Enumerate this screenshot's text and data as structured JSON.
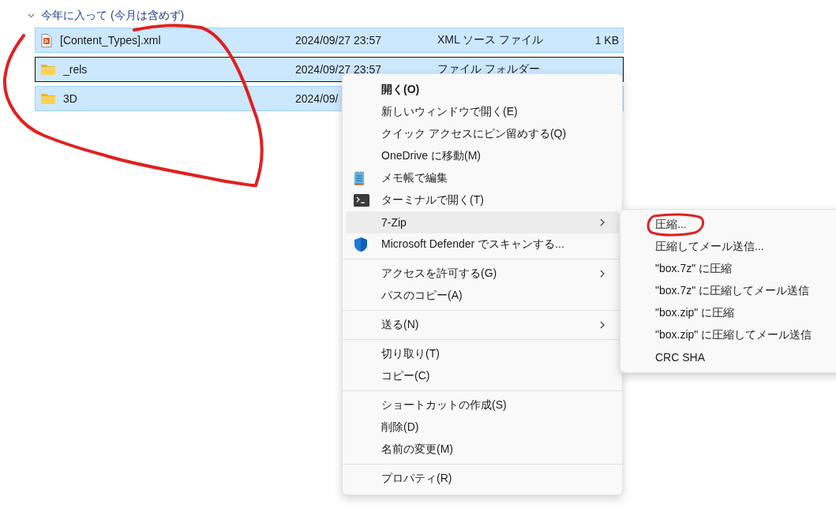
{
  "group": {
    "label": "今年に入って (今月は含めず)",
    "expanded": true
  },
  "files": {
    "circled": true,
    "rows": [
      {
        "kind": "xml",
        "name": "[Content_Types].xml",
        "date": "2024/09/27 23:57",
        "type": "XML ソース ファイル",
        "size": "1 KB",
        "selected": true,
        "focused": false
      },
      {
        "kind": "folder",
        "name": "_rels",
        "date": "2024/09/27 23:57",
        "type": "ファイル フォルダー",
        "selected": true,
        "focused": true
      },
      {
        "kind": "folder",
        "name": "3D",
        "date": "2024/09/",
        "selected": true,
        "focused": false
      }
    ]
  },
  "context_menu": {
    "items": [
      {
        "kind": "item",
        "label": "開く(O)",
        "bold": true,
        "submenu": false,
        "hovered": false
      },
      {
        "kind": "item",
        "label": "新しいウィンドウで開く(E)",
        "bold": false,
        "submenu": false,
        "hovered": false
      },
      {
        "kind": "item",
        "label": "クイック アクセスにピン留めする(Q)",
        "bold": false,
        "submenu": false,
        "hovered": false
      },
      {
        "kind": "item",
        "label": "OneDrive に移動(M)",
        "bold": false,
        "submenu": false,
        "hovered": false
      },
      {
        "kind": "notepad",
        "label": "メモ帳で編集",
        "bold": false,
        "submenu": false,
        "hovered": false
      },
      {
        "kind": "terminal",
        "label": "ターミナルで開く(T)",
        "bold": false,
        "submenu": false,
        "hovered": false
      },
      {
        "kind": "item",
        "label": "7-Zip",
        "bold": false,
        "submenu": true,
        "hovered": true
      },
      {
        "kind": "defender",
        "label": "Microsoft Defender でスキャンする...",
        "bold": false,
        "submenu": false,
        "hovered": false
      },
      {
        "kind": "separator"
      },
      {
        "kind": "item",
        "label": "アクセスを許可する(G)",
        "bold": false,
        "submenu": true,
        "hovered": false
      },
      {
        "kind": "item",
        "label": "パスのコピー(A)",
        "bold": false,
        "submenu": false,
        "hovered": false
      },
      {
        "kind": "separator"
      },
      {
        "kind": "item",
        "label": "送る(N)",
        "bold": false,
        "submenu": true,
        "hovered": false
      },
      {
        "kind": "separator"
      },
      {
        "kind": "item",
        "label": "切り取り(T)",
        "bold": false,
        "submenu": false,
        "hovered": false
      },
      {
        "kind": "item",
        "label": "コピー(C)",
        "bold": false,
        "submenu": false,
        "hovered": false
      },
      {
        "kind": "separator"
      },
      {
        "kind": "item",
        "label": "ショートカットの作成(S)",
        "bold": false,
        "submenu": false,
        "hovered": false
      },
      {
        "kind": "item",
        "label": "削除(D)",
        "bold": false,
        "submenu": false,
        "hovered": false
      },
      {
        "kind": "item",
        "label": "名前の変更(M)",
        "bold": false,
        "submenu": false,
        "hovered": false
      },
      {
        "kind": "separator"
      },
      {
        "kind": "item",
        "label": "プロパティ(R)",
        "bold": false,
        "submenu": false,
        "hovered": false
      }
    ]
  },
  "submenu": {
    "items": [
      {
        "label": "圧縮...",
        "circled": true
      },
      {
        "label": "圧縮してメール送信...",
        "circled": false
      },
      {
        "label": "\"box.7z\" に圧縮",
        "circled": false
      },
      {
        "label": "\"box.7z\" に圧縮してメール送信",
        "circled": false
      },
      {
        "label": "\"box.zip\" に圧縮",
        "circled": false
      },
      {
        "label": "\"box.zip\" に圧縮してメール送信",
        "circled": false
      },
      {
        "label": "CRC SHA",
        "circled": false
      }
    ]
  }
}
